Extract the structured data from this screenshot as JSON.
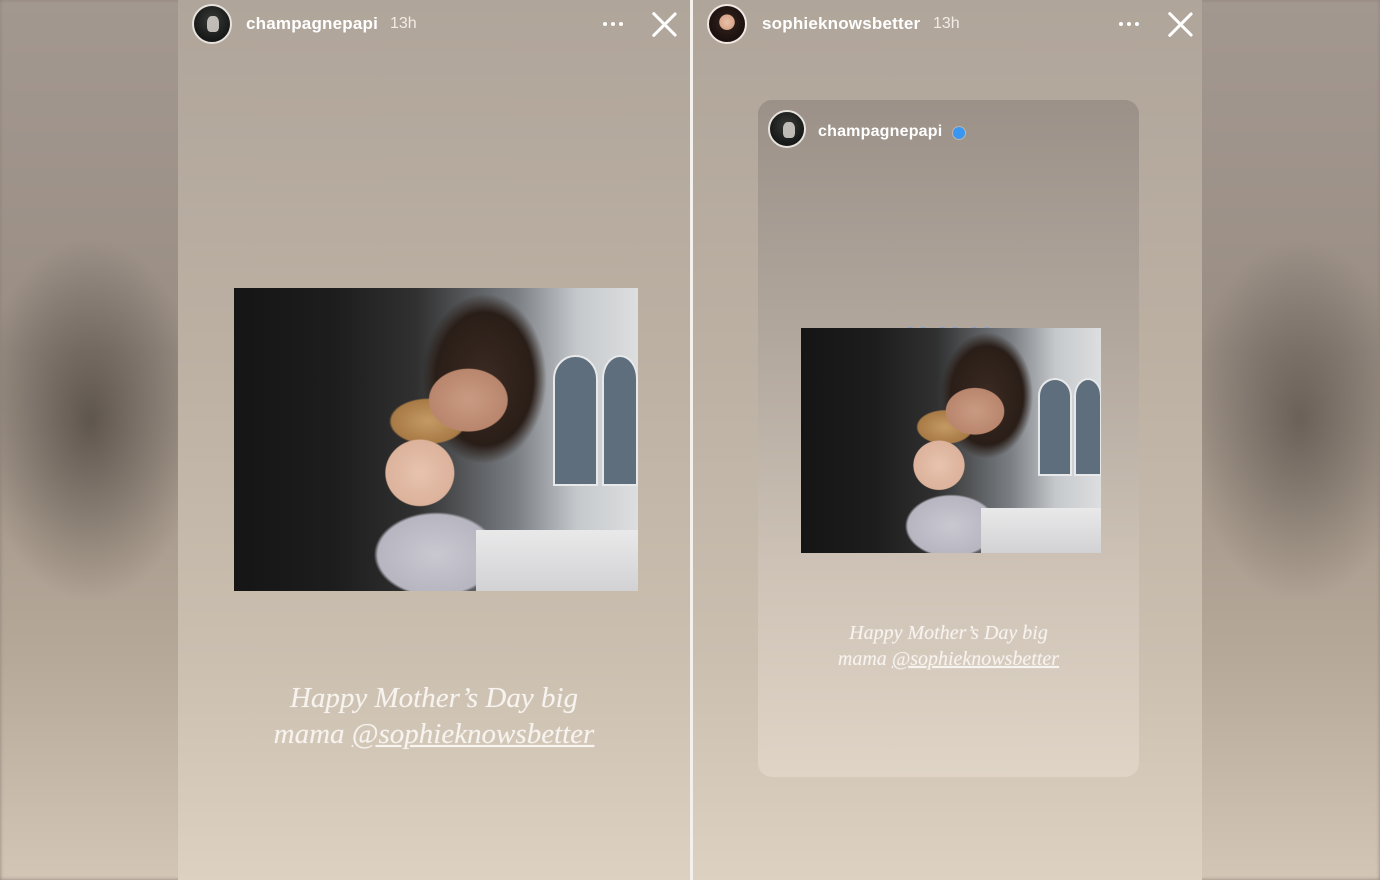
{
  "left_story": {
    "username": "champagnepapi",
    "timestamp": "13h",
    "caption_line1": "Happy Mother’s Day big",
    "caption_line2_prefix": "mama ",
    "caption_mention": "@sophieknowsbetter"
  },
  "right_story": {
    "username": "sophieknowsbetter",
    "timestamp": "13h",
    "shared_post": {
      "username": "champagnepapi",
      "emoji": "💙💙💙",
      "caption_line1": "Happy Mother’s Day big",
      "caption_line2_prefix": "mama ",
      "caption_mention": "@sophieknowsbetter"
    }
  },
  "colors": {
    "verified": "#3a97f1",
    "heart": "#1f6ff0"
  },
  "icons": [
    "more-options-icon",
    "close-icon",
    "verified-badge-icon",
    "blue-heart-icon"
  ]
}
